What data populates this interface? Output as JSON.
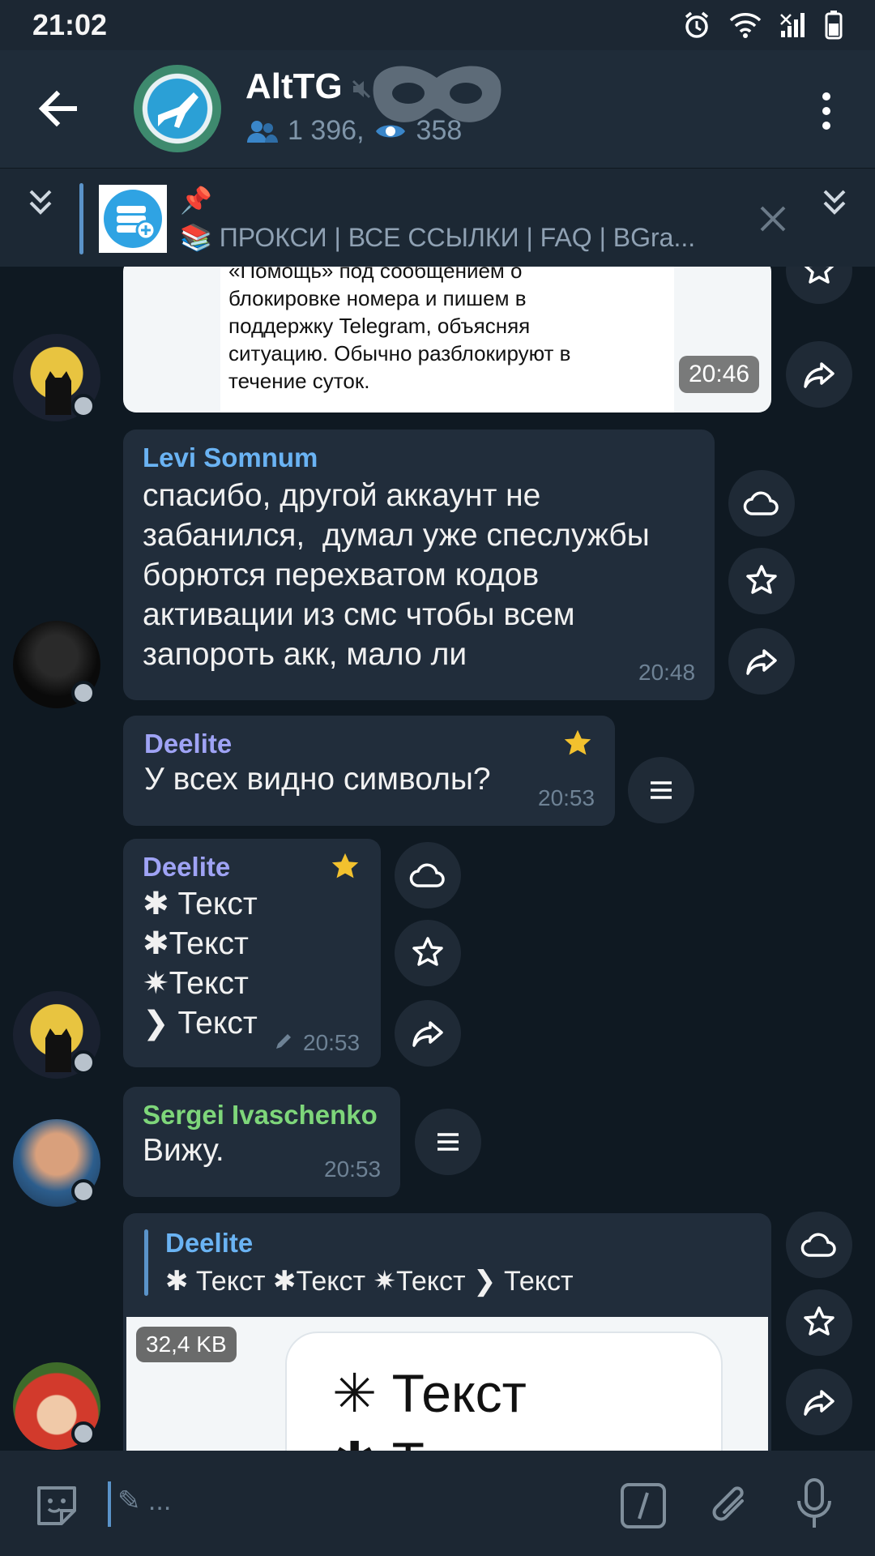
{
  "status_bar": {
    "time": "21:02"
  },
  "header": {
    "channel_name": "AltTG",
    "members_count": "1 396,",
    "online_count": "358"
  },
  "pinned": {
    "emoji_line": "📌",
    "text": "📚 ПРОКСИ | ВСЕ ССЫЛКИ | FAQ | BGra..."
  },
  "messages": [
    {
      "type": "image-text",
      "lines": "«Помощь» под сообщением о\nблокировке номера и пишем в\nподдержку Telegram, объясняя\nситуацию. Обычно разблокируют в\nтечение суток.",
      "time": "20:46"
    },
    {
      "sender": "Levi Somnum",
      "sender_color": "#6ab3f3",
      "text": "спасибо, другой аккаунт не\nзабанился,  думал уже спеслужбы\nборются перехватом кодов\nактивации из смс чтобы всем\nзапороть акк, мало ли",
      "time": "20:48"
    },
    {
      "sender": "Deelite",
      "sender_color": "#9fa3f5",
      "text": "У всех видно символы?",
      "time": "20:53"
    },
    {
      "sender": "Deelite",
      "sender_color": "#9fa3f5",
      "text": "✱ Текст\n✱Текст\n✷Текст\n❯ Текст",
      "time": "20:53"
    },
    {
      "sender": "Sergei Ivaschenko",
      "sender_color": "#7ed67a",
      "text": "Вижу.",
      "time": "20:53"
    },
    {
      "reply_name": "Deelite",
      "reply_text": "✱ Текст ✱Текст ✷Текст ❯ Текст",
      "file_size": "32,4 KB",
      "image_line1": "✳ Текст",
      "image_line2": "✱ Т"
    }
  ],
  "composer": {
    "placeholder": "✎ ..."
  },
  "colors": {
    "accent": "#5a93c9",
    "star": "#f2c12e",
    "bubble": "#212d3b",
    "background": "#0f1922"
  }
}
